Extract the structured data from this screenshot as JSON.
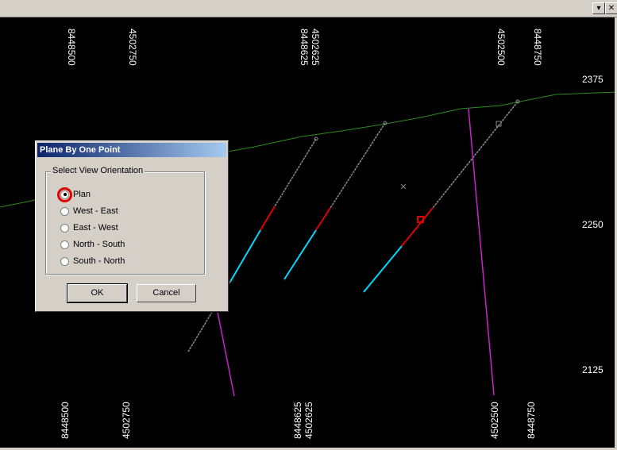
{
  "window": {
    "buttons": [
      {
        "name": "menu-arrow-button",
        "glyph": "▾"
      },
      {
        "name": "close-button",
        "glyph": "✕"
      }
    ]
  },
  "viewport": {
    "top_labels": [
      "8448500",
      "4502750",
      "8448625",
      "4502625",
      "4502500",
      "8448750"
    ],
    "bottom_labels": [
      "8448500",
      "4502750",
      "8448625",
      "4502625",
      "4502500",
      "8448750"
    ],
    "right_labels": [
      "2375",
      "2250",
      "2125"
    ],
    "colors": {
      "terrain": "#2e8b1e",
      "drillhole": "#8a8a8a",
      "red_segment": "#e00000",
      "cyan_segment": "#00d8ff",
      "magenta_line": "#cc22cc",
      "grid_labels": "#ffffff"
    }
  },
  "dialog": {
    "title": "Plane By One Point",
    "group_label": "Select View Orientation",
    "options": [
      {
        "label": "Plan",
        "checked": true
      },
      {
        "label": "West - East",
        "checked": false
      },
      {
        "label": "East - West",
        "checked": false
      },
      {
        "label": "North - South",
        "checked": false
      },
      {
        "label": "South - North",
        "checked": false
      }
    ],
    "ok_label": "OK",
    "cancel_label": "Cancel"
  }
}
